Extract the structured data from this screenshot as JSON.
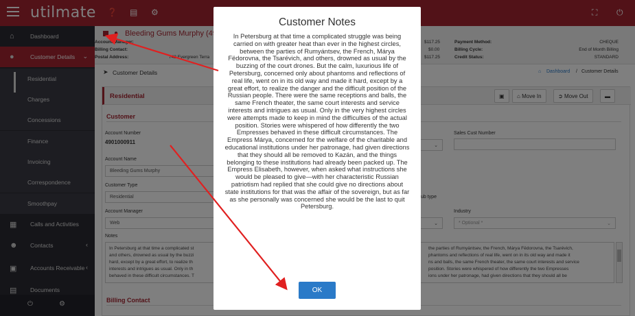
{
  "app": {
    "logo": "utilmate"
  },
  "topbar": {
    "icons": [
      "help-icon",
      "document-icon",
      "settings-icon",
      "fullscreen-icon",
      "power-icon"
    ]
  },
  "sidebar": {
    "items": [
      {
        "label": "Dashboard",
        "icon": "home-icon"
      },
      {
        "label": "Customer Details",
        "icon": "user-icon"
      },
      {
        "label": "Calls and Activities",
        "icon": "calendar-icon"
      },
      {
        "label": "Contacts",
        "icon": "contacts-icon"
      },
      {
        "label": "Accounts Receivable",
        "icon": "lock-icon"
      },
      {
        "label": "Documents",
        "icon": "documents-icon"
      }
    ],
    "subitems": [
      "Residential",
      "Charges",
      "Concessions",
      "Finance",
      "Invoicing",
      "Correspondence",
      "Smoothpay"
    ]
  },
  "header": {
    "account_name": "Bleeding Gums Murphy (49",
    "account_manager_label": "Account Manager:",
    "billing_contact_label": "Billing Contact:",
    "postal_address_label": "Postal Address:",
    "postal_address_value": "742 Evergreen Terra",
    "amounts": [
      "$117.25",
      "$0.00",
      "$117.25"
    ],
    "payment_method_label": "Payment Method:",
    "payment_method_value": "CHEQUE",
    "billing_cycle_label": "Billing Cycle:",
    "billing_cycle_value": "End of Month Billing",
    "credit_status_label": "Credit Status:",
    "credit_status_value": "STANDARD"
  },
  "breadcrumb": {
    "section": "Customer Details",
    "home": "Dashboard",
    "sep": "/",
    "current": "Customer Details"
  },
  "panel": {
    "title": "Residential",
    "move_in": "Move In",
    "move_out": "Move Out",
    "customer_section": "Customer",
    "account_number_label": "Account Number",
    "account_number_value": "4901000911",
    "sales_cust_number_label": "Sales Cust Number",
    "account_name_label": "Account Name",
    "account_name_value": "Bleeding Gums Murphy",
    "customer_type_label": "Customer Type",
    "customer_type_value": "Residential",
    "sub_type_label": "ub type",
    "account_manager_label": "Account Manager",
    "account_manager_value": "Web",
    "industry_label": "Industry",
    "industry_placeholder": "* Optional *",
    "notes_label": "Notes",
    "notes_left": "In Petersburg at that time a complicated st\nand others, drowned as usual by the buzzi\nhard, except by a great effort, to realize th\ninterests and intrigues as usual. Only in th\nbehaved in these difficult circumstances. T",
    "notes_right": "the parties of Rumyántsev, the French, Márya Fëdorovna, the Tsarévich,\nphantoms and reflections of real life, went on in its old way and made it\nns and balls, the same French theater, the same court interests and service\nposition. Stories were whispered of how differently the two Empresses\nions under her patronage, had given directions that they should all be",
    "billing_contact_section": "Billing Contact"
  },
  "modal": {
    "title": "Customer Notes",
    "body": "In Petersburg at that time a complicated struggle was being carried on with greater heat than ever in the highest circles, between the parties of Rumyántsev, the French, Márya Fëdorovna, the Tsarévich, and others, drowned as usual by the buzzing of the court drones. But the calm, luxurious life of Petersburg, concerned only about phantoms and reflections of real life, went on in its old way and made it hard, except by a great effort, to realize the danger and the difficult position of the Russian people. There were the same receptions and balls, the same French theater, the same court interests and service interests and intrigues as usual. Only in the very highest circles were attempts made to keep in mind the difficulties of the actual position. Stories were whispered of how differently the two Empresses behaved in these difficult circumstances. The Empress Márya, concerned for the welfare of the charitable and educational institutions under her patronage, had given directions that they should all be removed to Kazán, and the things belonging to these institutions had already been packed up. The Empress Elisabeth, however, when asked what instructions she would be pleased to give—with her characteristic Russian patriotism had replied that she could give no directions about state institutions for that was the affair of the sovereign, but as far as she personally was concerned she would be the last to quit Petersburg.",
    "ok_label": "OK"
  },
  "colors": {
    "brand": "#a52531",
    "sidebar": "#2b2b33",
    "ok": "#2a7ac8",
    "annotation": "#e02020"
  }
}
